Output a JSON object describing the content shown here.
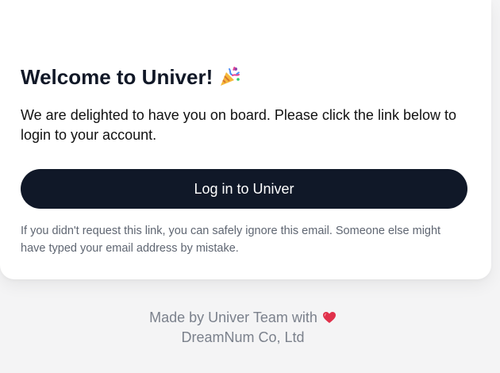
{
  "email": {
    "title": "Welcome to Univer!",
    "title_icon": "party-popper-icon",
    "intro": "We are delighted to have you on board. Please click the link below to login to your account.",
    "button_label": "Log in to Univer",
    "note": "If you didn't request this link, you can safely ignore this email. Someone else might have typed your email address by mistake."
  },
  "footer": {
    "line1": "Made by Univer Team with",
    "line1_icon": "heart-icon",
    "line2": "DreamNum Co, Ltd"
  },
  "colors": {
    "page_background": "#f4f4f5",
    "card_background": "#ffffff",
    "button_background": "#101828",
    "button_text": "#ffffff",
    "heart": "#e0314b"
  }
}
